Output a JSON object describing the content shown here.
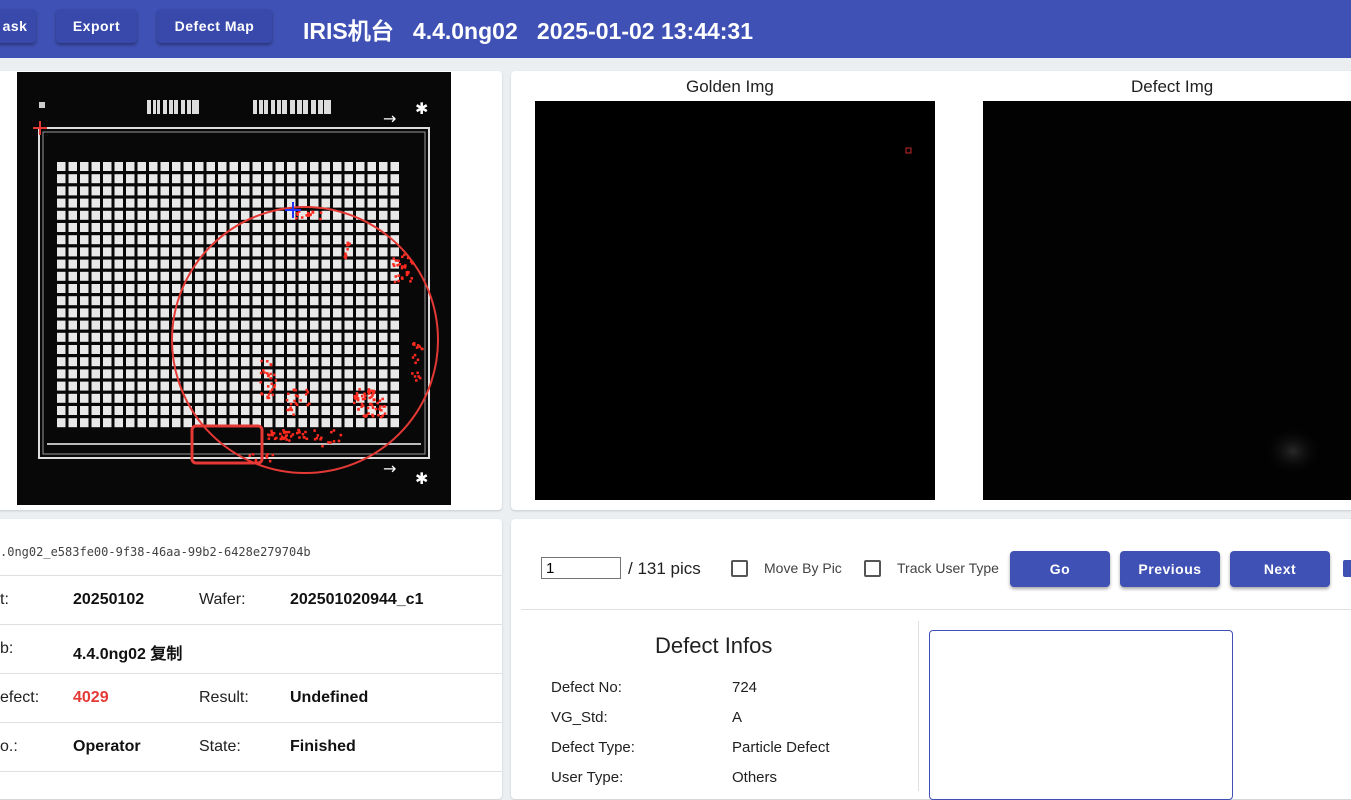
{
  "toolbar": {
    "task_label": "ask",
    "export_label": "Export",
    "defect_map_label": "Defect Map",
    "title": "IRIS机台   4.4.0ng02   2025-01-02 13:44:31"
  },
  "images": {
    "golden_label": "Golden Img",
    "defect_label": "Defect Img"
  },
  "lot_info": {
    "guid": ".0ng02_e583fe00-9f38-46aa-99b2-6428e279704b",
    "rows": [
      {
        "label1": "t:",
        "value1": "20250102",
        "label2": "Wafer:",
        "value2": "202501020944_c1"
      },
      {
        "label1": "b:",
        "value1": "4.4.0ng02 复制",
        "label2": "",
        "value2": ""
      },
      {
        "label1": "efect:",
        "value1": "4029",
        "label2": "Result:",
        "value2": "Undefined"
      },
      {
        "label1": "o.:",
        "value1": "Operator",
        "label2": "State:",
        "value2": "Finished"
      }
    ]
  },
  "nav": {
    "current_pic": "1",
    "total_pics": "/ 131 pics",
    "move_by_pic_label": "Move By Pic",
    "track_user_type_label": "Track User Type",
    "go_label": "Go",
    "previous_label": "Previous",
    "next_label": "Next"
  },
  "defect_infos": {
    "title": "Defect Infos",
    "fields": [
      {
        "label": "Defect No:",
        "value": "724"
      },
      {
        "label": "VG_Std:",
        "value": "A"
      },
      {
        "label": "Defect Type:",
        "value": "Particle Defect"
      },
      {
        "label": "User Type:",
        "value": "Others"
      }
    ]
  },
  "colors": {
    "primary": "#3f51b5",
    "button": "#3949ab",
    "defect_red": "#e53935"
  }
}
